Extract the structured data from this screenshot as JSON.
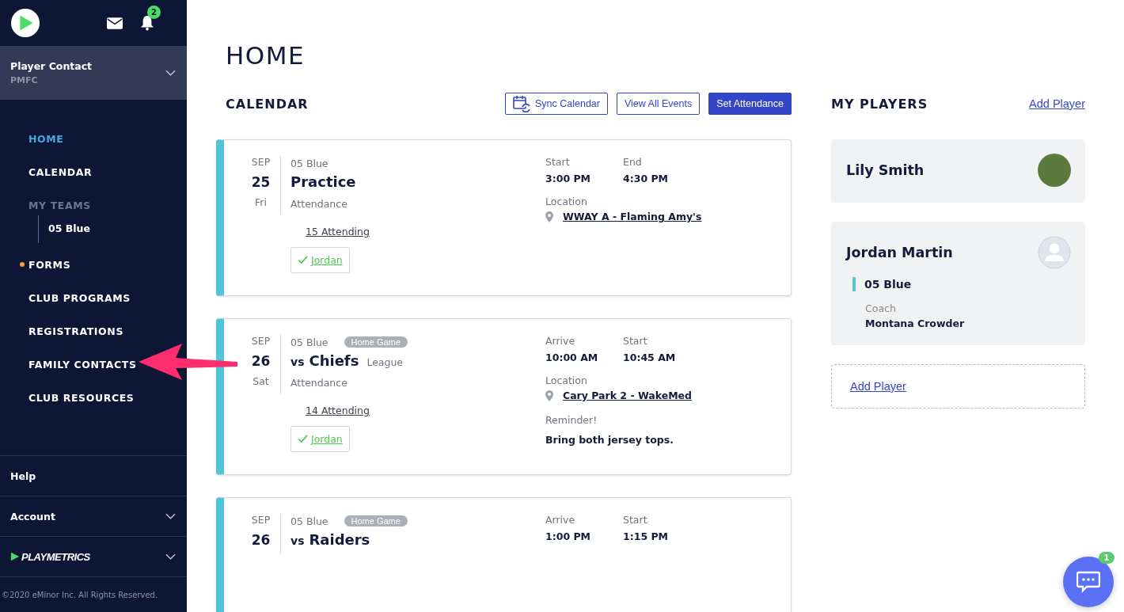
{
  "sidebar": {
    "notification_count": "2",
    "account": {
      "name": "Player Contact",
      "club": "PMFC"
    },
    "nav": [
      {
        "label": "HOME",
        "selected": true,
        "alert": false,
        "kind": "link"
      },
      {
        "label": "CALENDAR",
        "selected": false,
        "alert": false,
        "kind": "link"
      },
      {
        "label": "MY TEAMS",
        "kind": "header",
        "children": [
          {
            "label": "05 Blue",
            "selected": false
          }
        ]
      },
      {
        "label": "FORMS",
        "selected": false,
        "alert": true,
        "kind": "link"
      },
      {
        "label": "CLUB PROGRAMS",
        "selected": false,
        "alert": false,
        "kind": "link"
      },
      {
        "label": "REGISTRATIONS",
        "selected": false,
        "alert": false,
        "kind": "link"
      },
      {
        "label": "FAMILY CONTACTS",
        "selected": false,
        "alert": false,
        "kind": "link"
      },
      {
        "label": "CLUB RESOURCES",
        "selected": false,
        "alert": false,
        "kind": "link"
      }
    ],
    "footer": [
      {
        "label": "Help",
        "kind": "text"
      },
      {
        "label": "Account",
        "expandable": true,
        "kind": "text"
      },
      {
        "label": "PLAYMETRICS",
        "expandable": true,
        "kind": "brand"
      }
    ],
    "copyright": "©2020 eMinor Inc. All Rights Reserved."
  },
  "page_title": "HOME",
  "calendar": {
    "title": "CALENDAR",
    "buttons": [
      {
        "label": "Sync Calendar",
        "kind": "sync"
      },
      {
        "label": "View All Events",
        "kind": "outline"
      },
      {
        "label": "Set Attendance",
        "kind": "primary"
      }
    ],
    "events": [
      {
        "month": "SEP",
        "day": "25",
        "weekday": "Fri",
        "team": "05 Blue",
        "title": "Practice",
        "attendance_label": "Attendance",
        "attending": "15 Attending",
        "player": {
          "name": "Jordan",
          "attending": true
        },
        "times": [
          {
            "label": "Start",
            "value": "3:00 PM"
          },
          {
            "label": "End",
            "value": "4:30 PM"
          }
        ],
        "location_label": "Location",
        "location": "WWAY A - Flaming Amy's"
      },
      {
        "month": "SEP",
        "day": "26",
        "weekday": "Sat",
        "team": "05 Blue",
        "badge": "Home Game",
        "prefix": "vs",
        "title": "Chiefs",
        "subtitle": "League",
        "attendance_label": "Attendance",
        "attending": "14 Attending",
        "player": {
          "name": "Jordan",
          "attending": true
        },
        "times": [
          {
            "label": "Arrive",
            "value": "10:00 AM"
          },
          {
            "label": "Start",
            "value": "10:45 AM"
          }
        ],
        "location_label": "Location",
        "location": "Cary Park 2 - WakeMed",
        "reminder_label": "Reminder!",
        "reminder": "Bring both jersey tops."
      },
      {
        "month": "SEP",
        "day": "26",
        "team": "05 Blue",
        "badge": "Home Game",
        "prefix": "vs",
        "title": "Raiders",
        "times": [
          {
            "label": "Arrive",
            "value": "1:00 PM"
          },
          {
            "label": "Start",
            "value": "1:15 PM"
          }
        ]
      }
    ]
  },
  "players": {
    "title": "MY PLAYERS",
    "add_link": "Add Player",
    "items": [
      {
        "name": "Lily Smith",
        "avatar": {
          "kind": "photo"
        }
      },
      {
        "name": "Jordan Martin",
        "avatar": {
          "kind": "silhouette"
        },
        "team": "05 Blue",
        "coach_label": "Coach",
        "coach": "Montana Crowder"
      }
    ],
    "add_card": "Add Player"
  },
  "chat": {
    "badge": "1"
  }
}
